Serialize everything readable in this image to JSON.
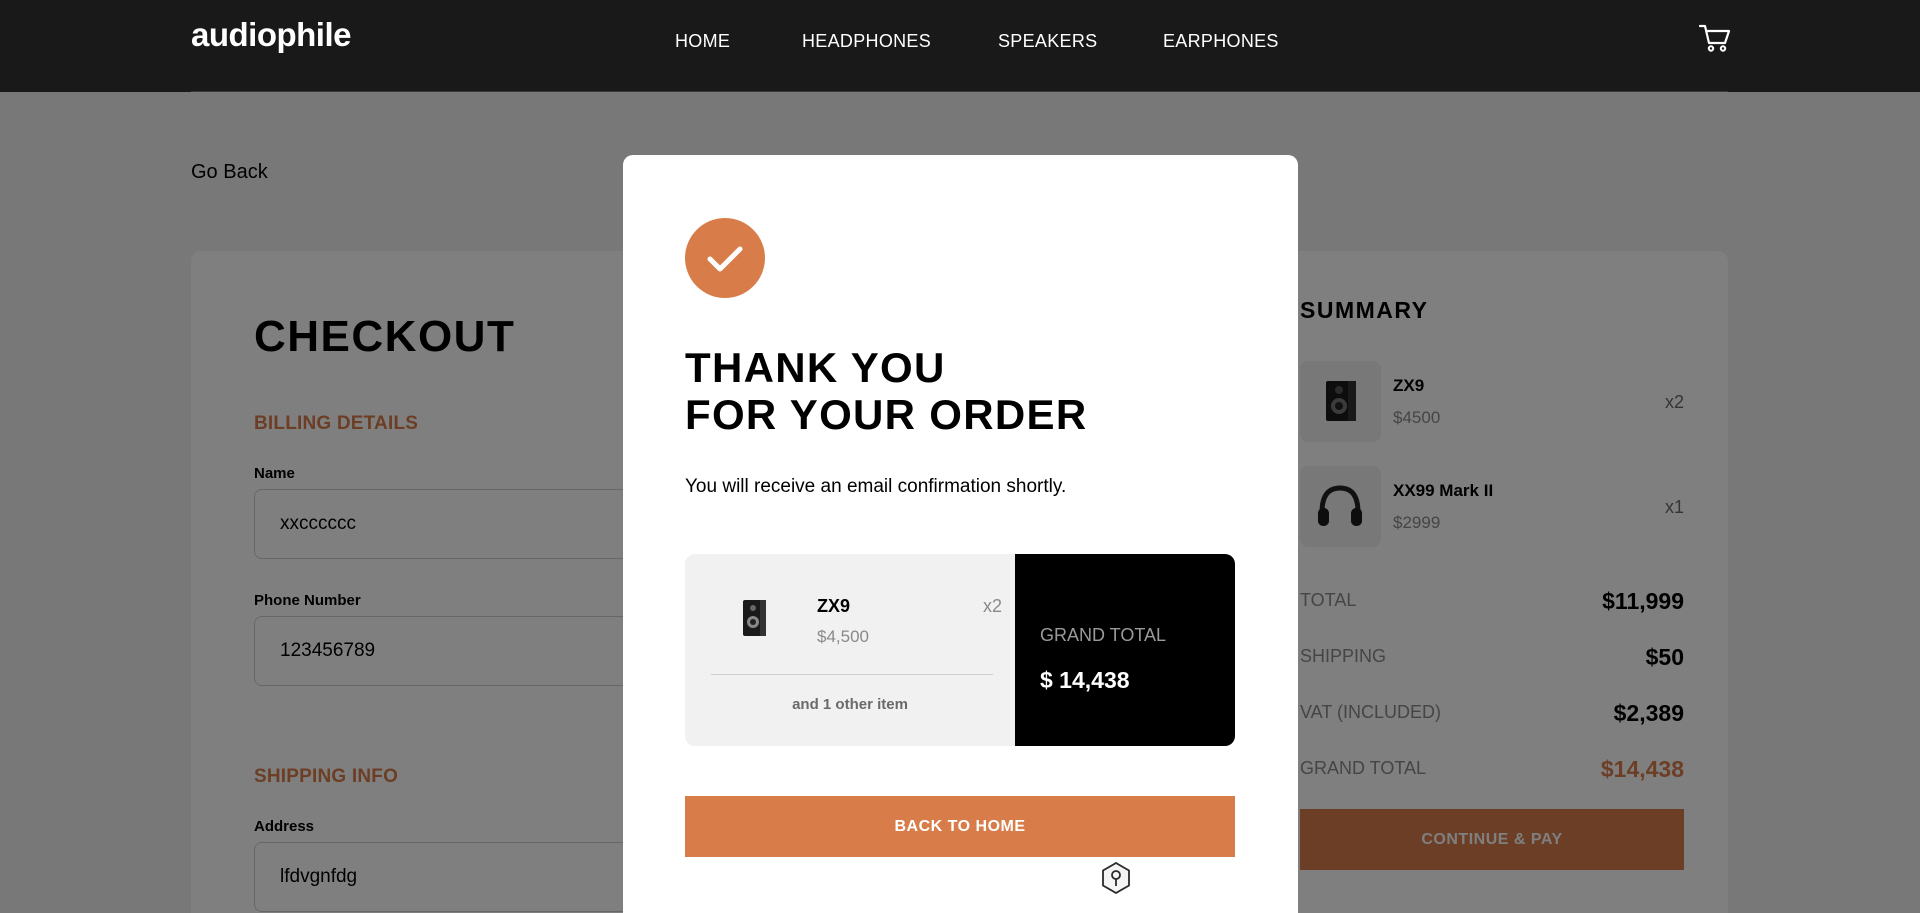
{
  "header": {
    "logo": "audiophile",
    "nav": [
      "HOME",
      "HEADPHONES",
      "SPEAKERS",
      "EARPHONES"
    ],
    "cart_icon": "cart-icon"
  },
  "page": {
    "go_back": "Go Back"
  },
  "checkout": {
    "title": "CHECKOUT",
    "billing_title": "BILLING DETAILS",
    "name_label": "Name",
    "name_value": "xxcccccc",
    "phone_label": "Phone Number",
    "phone_value": "123456789",
    "shipping_title": "SHIPPING INFO",
    "address_label": "Address",
    "address_value": "lfdvgnfdg"
  },
  "summary": {
    "title": "SUMMARY",
    "items": [
      {
        "name": "ZX9",
        "price": "$4500",
        "qty": "x2",
        "icon": "speaker-icon"
      },
      {
        "name": "XX99 Mark II",
        "price": "$2999",
        "qty": "x1",
        "icon": "headphones-icon"
      }
    ],
    "rows": [
      {
        "label": "TOTAL",
        "value": "$11,999"
      },
      {
        "label": "SHIPPING",
        "value": "$50"
      },
      {
        "label": "VAT (INCLUDED)",
        "value": "$2,389"
      },
      {
        "label": "GRAND TOTAL",
        "value": "$14,438"
      }
    ],
    "continue_label": "CONTINUE & PAY"
  },
  "modal": {
    "title_line1": "THANK YOU",
    "title_line2": "FOR YOUR ORDER",
    "subtitle": "You will receive an email confirmation shortly.",
    "item": {
      "name": "ZX9",
      "price": "$4,500",
      "qty": "x2",
      "icon": "speaker-icon"
    },
    "other_items": "and 1 other item",
    "grand_total_label": "GRAND TOTAL",
    "grand_total_value": "$ 14,438",
    "back_home_label": "BACK TO HOME"
  },
  "colors": {
    "accent": "#d87d4a",
    "header_bg": "#191919",
    "grand_total_accent": "#d87d4a"
  }
}
